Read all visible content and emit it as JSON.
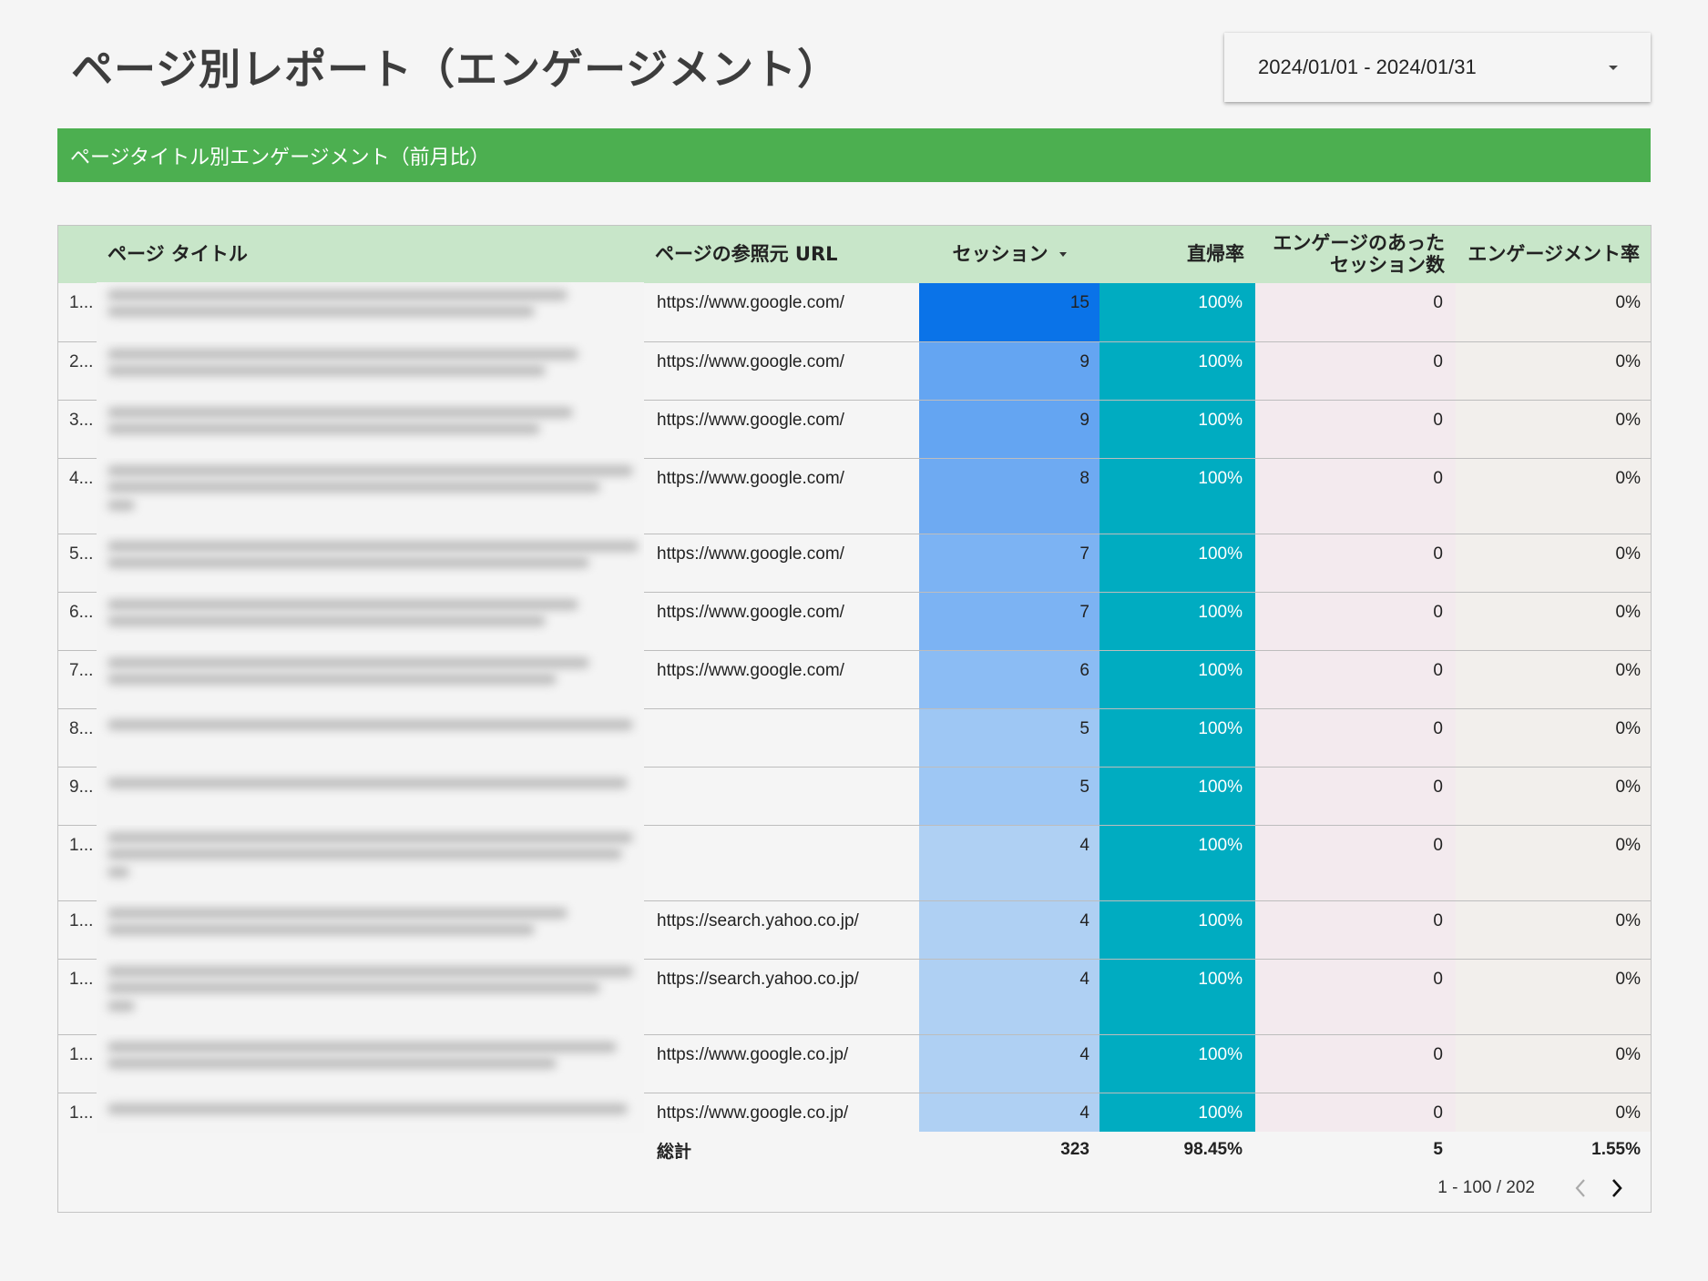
{
  "page": {
    "title": "ページ別レポート（エンゲージメント）"
  },
  "date_range": {
    "value": "2024/01/01 - 2024/01/31",
    "icon": "caret-down-icon"
  },
  "section": {
    "title": "ページタイトル別エンゲージメント（前月比）",
    "color": "#4caf50"
  },
  "table": {
    "columns": [
      {
        "label": "ページ タイトル"
      },
      {
        "label": "ページの参照元 URL"
      },
      {
        "label": "セッション",
        "sorted": "desc"
      },
      {
        "label": "直帰率"
      },
      {
        "label": "エンゲージのあったセッション数"
      },
      {
        "label": "エンゲージメント率"
      }
    ],
    "rows": [
      {
        "index": "1...",
        "title": "",
        "url": "https://www.google.com/",
        "sessions": "15",
        "bounce": "100%",
        "engaged": "0",
        "rate": "0%"
      },
      {
        "index": "2...",
        "title": "",
        "url": "https://www.google.com/",
        "sessions": "9",
        "bounce": "100%",
        "engaged": "0",
        "rate": "0%"
      },
      {
        "index": "3...",
        "title": "",
        "url": "https://www.google.com/",
        "sessions": "9",
        "bounce": "100%",
        "engaged": "0",
        "rate": "0%"
      },
      {
        "index": "4...",
        "title": "",
        "url": "https://www.google.com/",
        "sessions": "8",
        "bounce": "100%",
        "engaged": "0",
        "rate": "0%"
      },
      {
        "index": "5...",
        "title": "",
        "url": "https://www.google.com/",
        "sessions": "7",
        "bounce": "100%",
        "engaged": "0",
        "rate": "0%"
      },
      {
        "index": "6...",
        "title": "",
        "url": "https://www.google.com/",
        "sessions": "7",
        "bounce": "100%",
        "engaged": "0",
        "rate": "0%"
      },
      {
        "index": "7...",
        "title": "",
        "url": "https://www.google.com/",
        "sessions": "6",
        "bounce": "100%",
        "engaged": "0",
        "rate": "0%"
      },
      {
        "index": "8...",
        "title": "",
        "url": "",
        "sessions": "5",
        "bounce": "100%",
        "engaged": "0",
        "rate": "0%"
      },
      {
        "index": "9...",
        "title": "",
        "url": "",
        "sessions": "5",
        "bounce": "100%",
        "engaged": "0",
        "rate": "0%"
      },
      {
        "index": "1...",
        "title": "",
        "url": "",
        "sessions": "4",
        "bounce": "100%",
        "engaged": "0",
        "rate": "0%"
      },
      {
        "index": "1...",
        "title": "",
        "url": "https://search.yahoo.co.jp/",
        "sessions": "4",
        "bounce": "100%",
        "engaged": "0",
        "rate": "0%"
      },
      {
        "index": "1...",
        "title": "",
        "url": "https://search.yahoo.co.jp/",
        "sessions": "4",
        "bounce": "100%",
        "engaged": "0",
        "rate": "0%"
      },
      {
        "index": "1...",
        "title": "",
        "url": "https://www.google.co.jp/",
        "sessions": "4",
        "bounce": "100%",
        "engaged": "0",
        "rate": "0%"
      },
      {
        "index": "1...",
        "title": "",
        "url": "https://www.google.co.jp/",
        "sessions": "4",
        "bounce": "100%",
        "engaged": "0",
        "rate": "0%"
      }
    ],
    "totals": {
      "label": "総計",
      "sessions": "323",
      "bounce": "98.45%",
      "engaged": "5",
      "rate": "1.55%"
    },
    "heatmap_colors": {
      "15": "#0a73e8",
      "9": "#64a5f2",
      "8": "#6eaaf2",
      "7": "#7cb3f3",
      "6": "#8bbcf4",
      "5": "#9ec7f4",
      "4": "#afd0f3"
    },
    "colors": {
      "header": "#c8e6c9",
      "bounce": "#00acc1",
      "engaged": "#f3eaee",
      "rate": "#f2efec"
    }
  },
  "pagination": {
    "text": "1 - 100 / 202",
    "prev_icon": "chevron-left-icon",
    "next_icon": "chevron-right-icon"
  }
}
